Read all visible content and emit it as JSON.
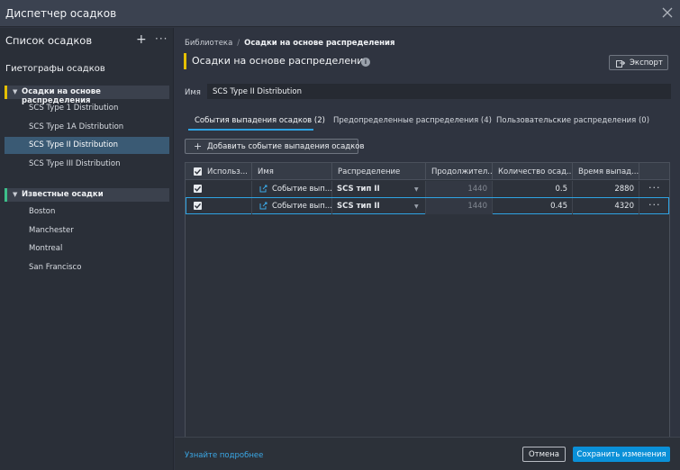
{
  "window": {
    "title": "Диспетчер осадков"
  },
  "sidebar": {
    "list_title": "Список осадков",
    "hyetograph_section": "Гиетографы осадков",
    "groups": [
      {
        "label": "Осадки на основе распределения",
        "color": "#e5c000",
        "items": [
          {
            "label": "SCS Type 1 Distribution"
          },
          {
            "label": "SCS Type 1A Distribution"
          },
          {
            "label": "SCS Type II Distribution"
          },
          {
            "label": "SCS Type III Distribution"
          }
        ]
      },
      {
        "label": "Известные осадки",
        "color": "#3dbf8a",
        "items": [
          {
            "label": "Boston"
          },
          {
            "label": "Manchester"
          },
          {
            "label": "Montreal"
          },
          {
            "label": "San Francisco"
          }
        ]
      }
    ]
  },
  "main": {
    "breadcrumb": {
      "root": "Библиотека",
      "separator": "/",
      "current": "Осадки на основе распределения"
    },
    "page_title": "Осадки на основе распределения",
    "export_label": "Экспорт",
    "name_label": "Имя",
    "name_value": "SCS Type II Distribution",
    "tabs": [
      {
        "label": "События выпадения осадков (2)"
      },
      {
        "label": "Предопределенные распределения (4)"
      },
      {
        "label": "Пользовательские распределения (0)"
      }
    ],
    "add_event_label": "Добавить событие выпадения осадков",
    "grid": {
      "columns": [
        "Использ...",
        "Имя",
        "Распределение",
        "Продолжител...",
        "Количество осад...",
        "Время выпад..."
      ],
      "rows": [
        {
          "name": "Событие вып...",
          "distribution": "SCS тип II",
          "duration": "1440",
          "amount": "0.5",
          "time": "2880"
        },
        {
          "name": "Событие вып...",
          "distribution": "SCS тип II",
          "duration": "1440",
          "amount": "0.45",
          "time": "4320"
        }
      ]
    }
  },
  "footer": {
    "learn_more": "Узнайте подробнее",
    "cancel_label": "Отмена",
    "save_label": "Сохранить изменения"
  }
}
